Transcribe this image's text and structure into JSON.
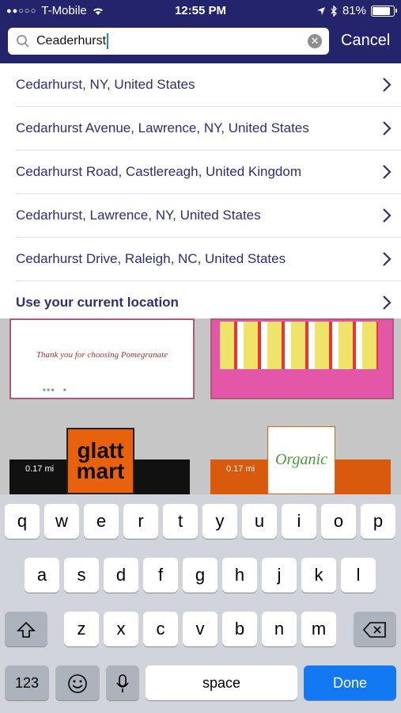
{
  "status_bar": {
    "signal": "●●○○○",
    "carrier": "T-Mobile",
    "time": "12:55 PM",
    "battery": "81%"
  },
  "search": {
    "value": "Ceaderhurst",
    "cancel_label": "Cancel"
  },
  "suggestions": [
    {
      "label": "Cedarhurst, NY, United States"
    },
    {
      "label": "Cedarhurst Avenue, Lawrence, NY, United States"
    },
    {
      "label": "Cedarhurst Road, Castlereagh, United Kingdom"
    },
    {
      "label": "Cedarhurst, Lawrence, NY, United States"
    },
    {
      "label": "Cedarhurst Drive, Raleigh, NC, United States"
    },
    {
      "label": "Use your current location"
    }
  ],
  "background": {
    "card_left_text": "Thank you for choosing Pomegranate",
    "distance_left": "0.17 mi",
    "distance_right": "0.17 mi",
    "glatt_logo": "glatt mart",
    "organic_logo": "Organic"
  },
  "keyboard": {
    "row1": [
      "q",
      "w",
      "e",
      "r",
      "t",
      "y",
      "u",
      "i",
      "o",
      "p"
    ],
    "row2": [
      "a",
      "s",
      "d",
      "f",
      "g",
      "h",
      "j",
      "k",
      "l"
    ],
    "row3": [
      "z",
      "x",
      "c",
      "v",
      "b",
      "n",
      "m"
    ],
    "numbers_label": "123",
    "space_label": "space",
    "done_label": "Done"
  },
  "colors": {
    "header": "#23246b",
    "link_text": "#2d2e75",
    "done_key": "#1279f3"
  }
}
